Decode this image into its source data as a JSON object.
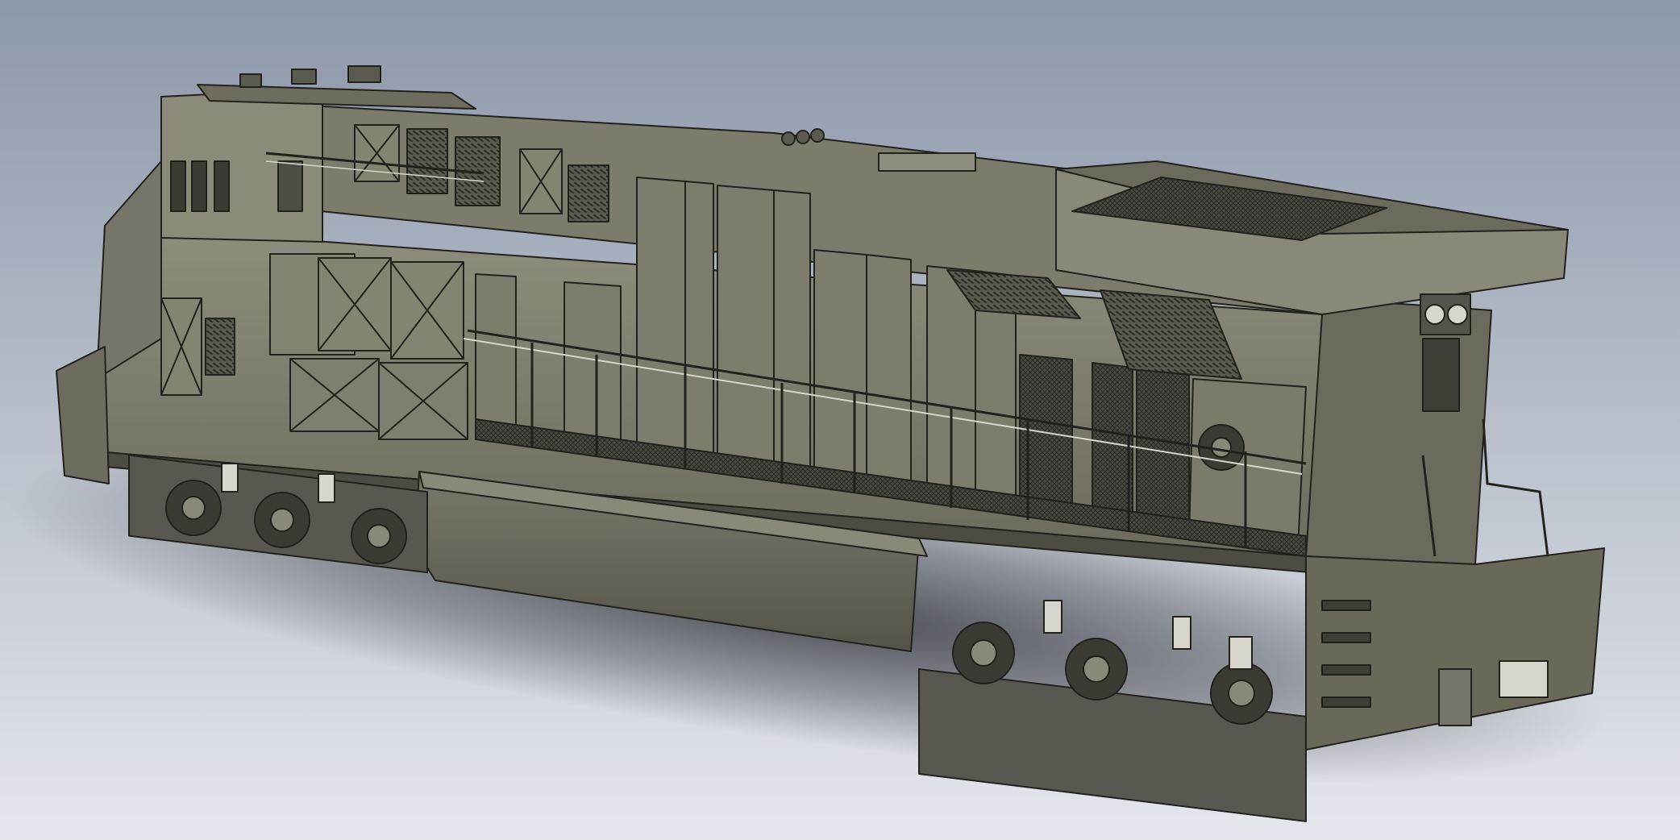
{
  "scene": {
    "subject": "locomotive-cad-model",
    "colors": {
      "background_top": "#8c97a9",
      "background_bottom": "#e4e7ec",
      "body_light": "#8e8c7a",
      "body_mid": "#6f6d5f",
      "body_dark": "#4f4e44",
      "roof": "#7d7b6c",
      "outline": "#22221d",
      "grille": "#3a3a34",
      "chrome": "#d8d6cc",
      "shadow": "#1f2128"
    }
  }
}
